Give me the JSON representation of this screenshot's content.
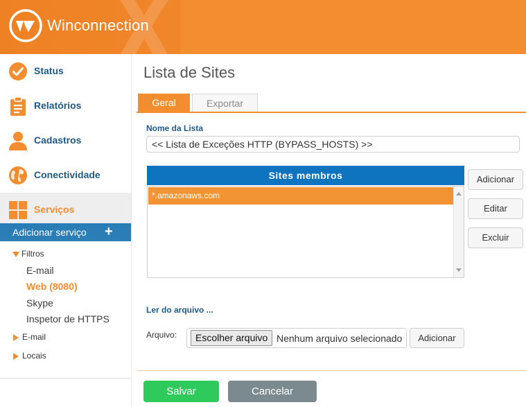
{
  "brand": {
    "name": "Winconnection"
  },
  "colors": {
    "accent": "#f28d30",
    "primary_blue": "#0f74bf",
    "nav_text": "#1d5a86",
    "save": "#2ecb5c",
    "cancel": "#7b8a8f"
  },
  "sidebar": {
    "nav": [
      {
        "label": "Status",
        "icon": "check-circle-icon"
      },
      {
        "label": "Relatórios",
        "icon": "clipboard-icon"
      },
      {
        "label": "Cadastros",
        "icon": "user-icon"
      },
      {
        "label": "Conectividade",
        "icon": "globe-icon"
      },
      {
        "label": "Serviços",
        "icon": "grid-icon"
      }
    ],
    "add_service": {
      "label": "Adicionar serviço",
      "icon": "plus-icon"
    },
    "tree": {
      "filtros": "Filtros",
      "filtros_items": [
        "E-mail",
        "Web (8080)",
        "Skype",
        "Inspetor de HTTPS"
      ],
      "email": "E-mail",
      "locais": "Locais"
    }
  },
  "main": {
    "title": "Lista de Sites",
    "tabs": [
      {
        "label": "Geral"
      },
      {
        "label": "Exportar"
      }
    ],
    "list_name_label": "Nome da Lista",
    "list_name_value": "<< Lista de Exceções HTTP (BYPASS_HOSTS) >>",
    "members": {
      "header": "Sites membros",
      "items": [
        "*.amazonaws.com"
      ]
    },
    "buttons": {
      "add": "Adicionar",
      "edit": "Editar",
      "delete": "Excluir"
    },
    "read_file_label": "Ler do arquivo ...",
    "file_label": "Arquivo:",
    "choose_file": "Escolher arquivo",
    "no_file": "Nenhum arquivo selecionado",
    "file_add": "Adicionar",
    "save": "Salvar",
    "cancel": "Cancelar"
  }
}
